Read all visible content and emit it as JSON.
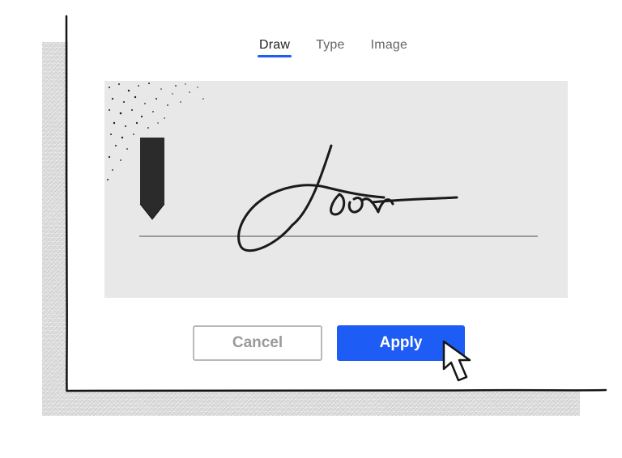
{
  "tabs": [
    {
      "label": "Draw",
      "active": true
    },
    {
      "label": "Type",
      "active": false
    },
    {
      "label": "Image",
      "active": false
    }
  ],
  "buttons": {
    "cancel_label": "Cancel",
    "apply_label": "Apply"
  },
  "icons": {
    "pen": "pen-nib-icon",
    "cursor": "mouse-pointer-icon"
  },
  "colors": {
    "accent": "#1d5cf5",
    "pad_background": "#e8e8e8",
    "ink": "#1a1a1a"
  }
}
